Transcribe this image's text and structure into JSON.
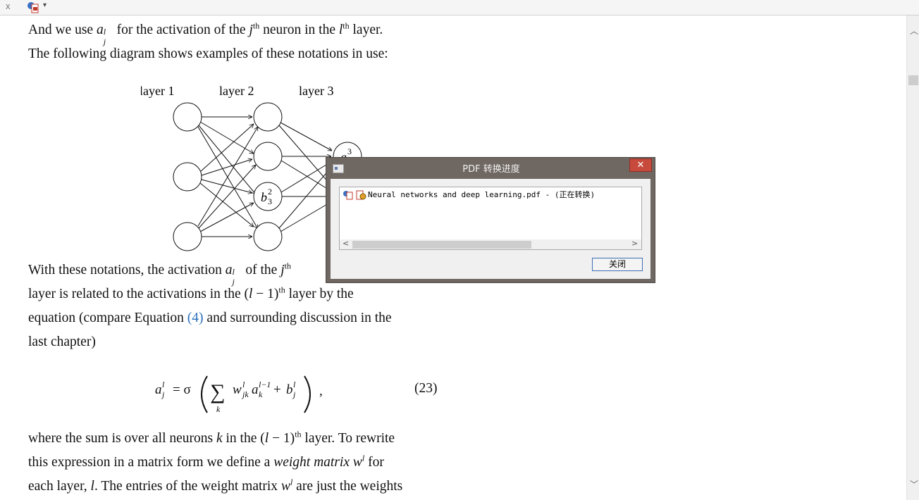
{
  "toolbar": {
    "close_glyph": "x",
    "pdf_icon": "pdf-converter-icon",
    "caret": "▾"
  },
  "article": {
    "line1": {
      "a": "And we use ",
      "b": " for the activation of the ",
      "c": " neuron in the ",
      "d": " layer."
    },
    "line2": "The following diagram shows examples of these notations in use:",
    "diagram": {
      "layers": [
        "layer 1",
        "layer 2",
        "layer 3"
      ],
      "b_label": "b",
      "a_label": "a"
    },
    "para2": {
      "l1a": "With these notations, the activation ",
      "l1b": " of the ",
      "l2a": "layer is related to the activations in the ",
      "l2b": " layer by the",
      "l3a": "equation (compare Equation ",
      "l3link": "(4)",
      "l3b": " and surrounding discussion in the",
      "l4": "last chapter)"
    },
    "equation_number": "(23)",
    "para3": {
      "l1a": "where the sum is over all neurons ",
      "l1b": " in the ",
      "l1c": " layer. To rewrite",
      "l2a": "this expression in a matrix form we define a ",
      "l2em": "weight matrix",
      "l2b": " for",
      "l3a": "each layer, ",
      "l3b": ". The entries of the weight matrix ",
      "l3c": " are just the weights"
    }
  },
  "dialog": {
    "title": "PDF 转换进度",
    "close_glyph": "✕",
    "file_item": "Neural networks and deep learning.pdf - (正在转换)",
    "button_label": "关闭",
    "scroll_left": "<",
    "scroll_right": ">"
  },
  "scrollbar": {
    "up": "︿",
    "down": "﹀"
  }
}
